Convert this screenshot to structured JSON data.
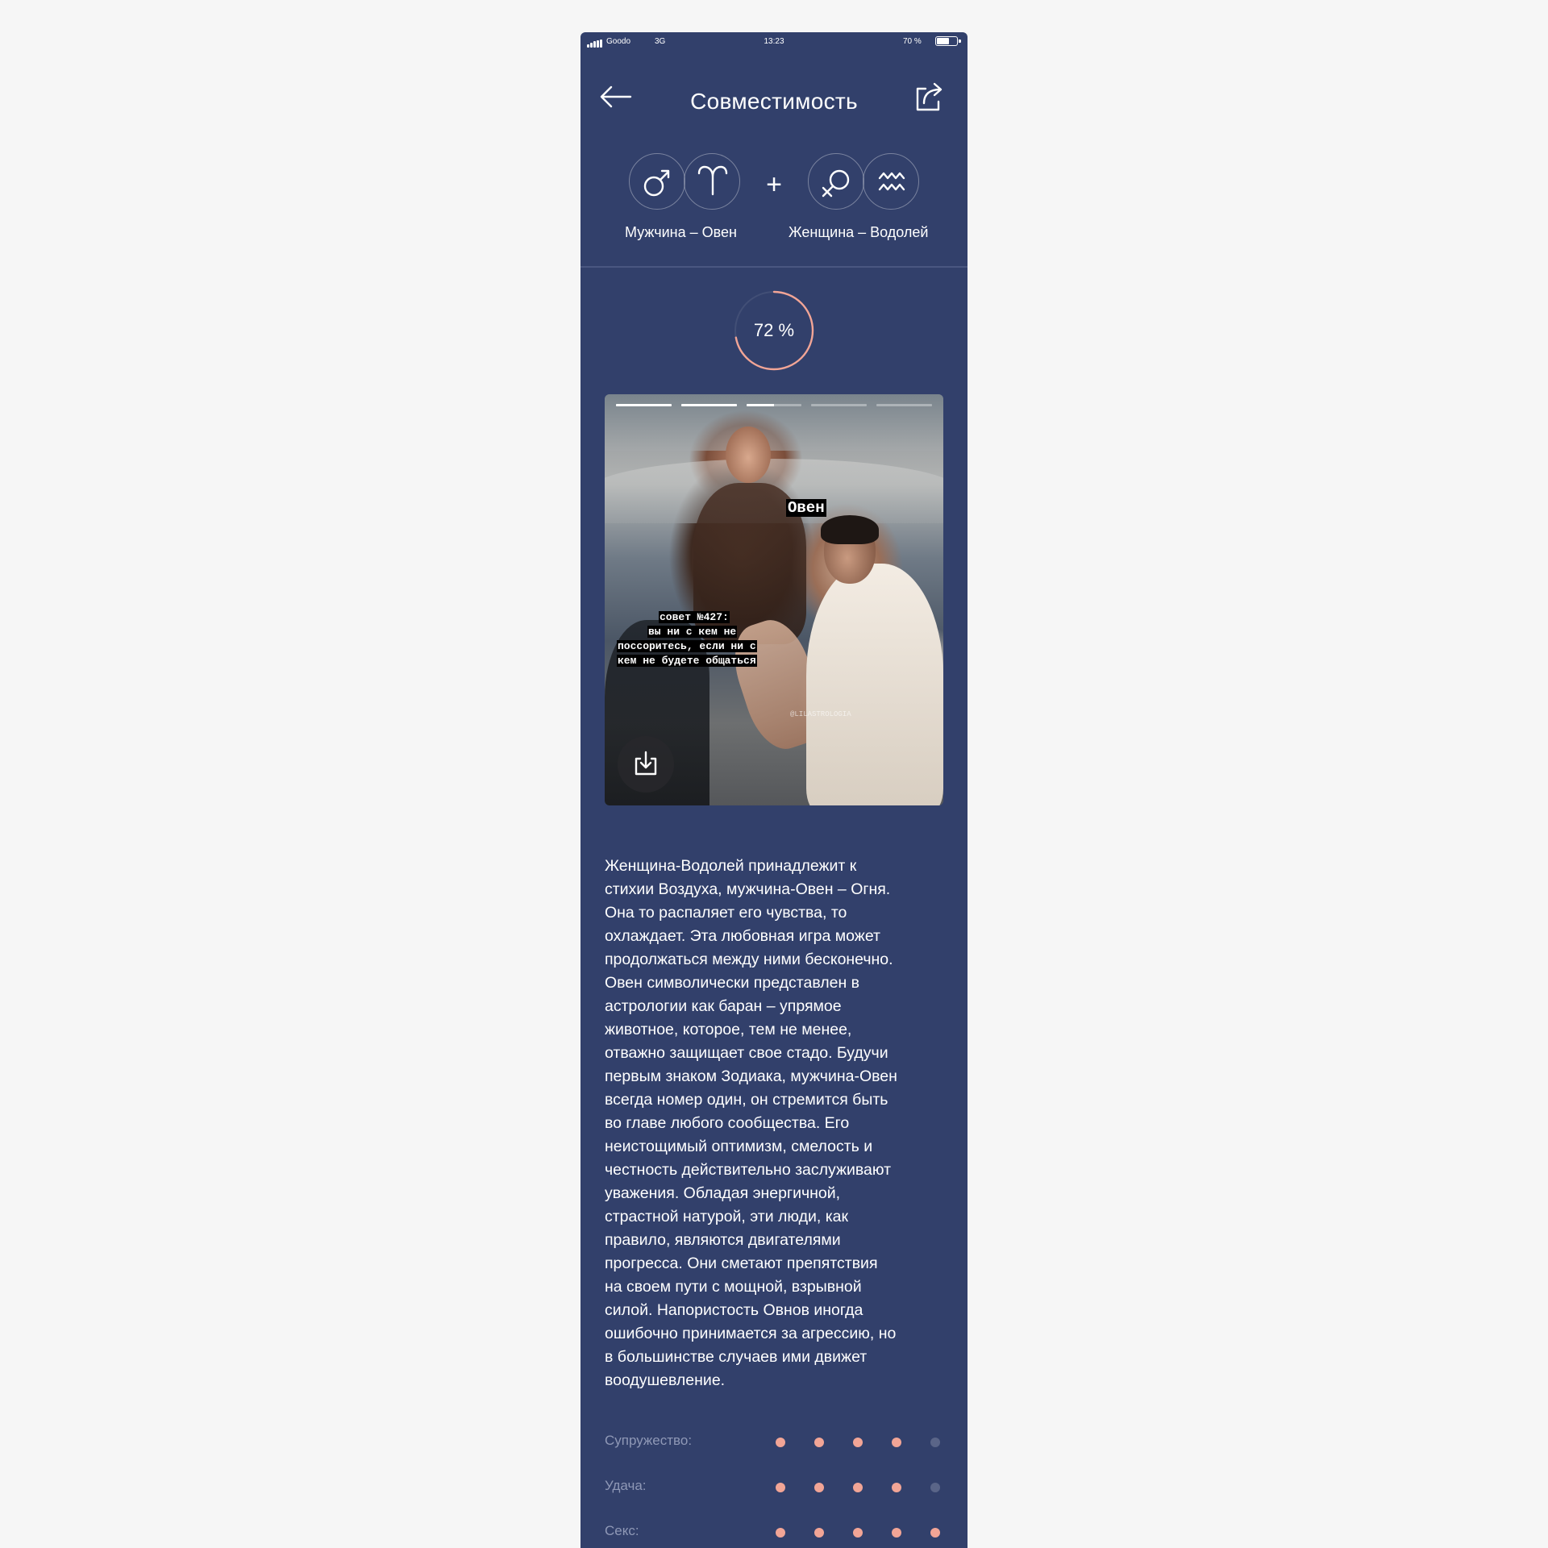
{
  "status_bar": {
    "carrier": "Goodo",
    "network": "3G",
    "time": "13:23",
    "battery": "70 %",
    "battery_level": 0.7
  },
  "header": {
    "title": "Совместимость",
    "back_icon": "arrow-left-icon",
    "share_icon": "share-icon"
  },
  "pair": {
    "man": {
      "gender_icon": "male-symbol-icon",
      "sign_icon": "aries-icon",
      "label": "Мужчина – Овен"
    },
    "plus": "+",
    "woman": {
      "gender_icon": "female-symbol-icon",
      "sign_icon": "aquarius-icon",
      "label": "Женщина – Водолей"
    }
  },
  "compatibility": {
    "percent": 72,
    "label": "72 %"
  },
  "story": {
    "segments": [
      1.0,
      1.0,
      0.5,
      0.0,
      0.0
    ],
    "caption_sign": "Овен",
    "tip_lines": [
      "совет №427:",
      "вы ни с кем не",
      "поссоритесь, если ни с",
      "кем не будете общаться"
    ],
    "watermark": "@LILASTROLOGIA",
    "download_icon": "download-icon"
  },
  "description": "Женщина-Водолей принадлежит к\nстихии Воздуха, мужчина-Овен – Огня.\nОна то распаляет его чувства, то\nохлаждает. Эта любовная игра может\nпродолжаться между ними бесконечно.\nОвен символически представлен в\nастрологии как баран – упрямое\nживотное, которое, тем не менее,\nотважно защищает свое стадо. Будучи\nпервым знаком Зодиака, мужчина-Овен\nвсегда номер один, он стремится быть\nво главе любого сообщества. Его\nнеистощимый оптимизм, смелость и\nчестность действительно заслуживают\nуважения. Обладая энергичной,\nстрастной натурой, эти люди, как\nправило, являются двигателями\nпрогресса. Они сметают препятствия\nна своем пути с мощной, взрывной\nсилой. Напористость Овнов иногда\nошибочно принимается за агрессию, но\nв большинстве случаев ими движет\nвоодушевление.",
  "ratings": [
    {
      "label": "Супружество:",
      "score": 4,
      "max": 5
    },
    {
      "label": "Удача:",
      "score": 4,
      "max": 5
    },
    {
      "label": "Секс:",
      "score": 5,
      "max": 5
    }
  ],
  "colors": {
    "background": "#32406b",
    "accent": "#f2a596",
    "dot_inactive": "#5a6588",
    "label_muted": "#8f98b6"
  }
}
